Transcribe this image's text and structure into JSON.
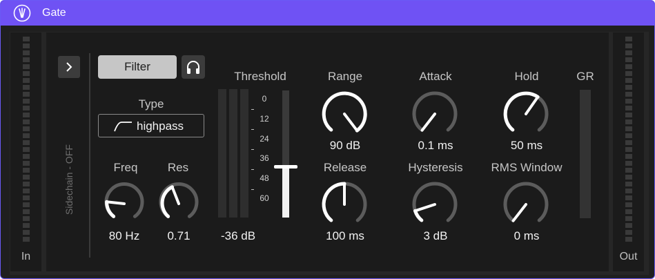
{
  "window": {
    "title": "Gate"
  },
  "meters": {
    "in_label": "In",
    "out_label": "Out"
  },
  "sidechain": {
    "label": "Sidechain - OFF"
  },
  "filter": {
    "button_label": "Filter",
    "type_label": "Type",
    "type_value": "highpass"
  },
  "freq": {
    "label": "Freq",
    "value": "80 Hz"
  },
  "res": {
    "label": "Res",
    "value": "0.71"
  },
  "threshold": {
    "label": "Threshold",
    "value": "-36 dB",
    "scale": [
      "0",
      "12",
      "24",
      "36",
      "48",
      "60"
    ],
    "level_db": -36
  },
  "range": {
    "label": "Range",
    "value": "90 dB"
  },
  "release": {
    "label": "Release",
    "value": "100 ms"
  },
  "attack": {
    "label": "Attack",
    "value": "0.1 ms"
  },
  "hysteresis": {
    "label": "Hysteresis",
    "value": "3 dB"
  },
  "hold": {
    "label": "Hold",
    "value": "50 ms"
  },
  "rms_window": {
    "label": "RMS Window",
    "value": "0 ms"
  },
  "gr": {
    "label": "GR"
  },
  "colors": {
    "accent": "#6f52f4",
    "panel": "#1b1b1b",
    "knob_arc": "#ffffff",
    "knob_track": "#5c5c5c"
  }
}
